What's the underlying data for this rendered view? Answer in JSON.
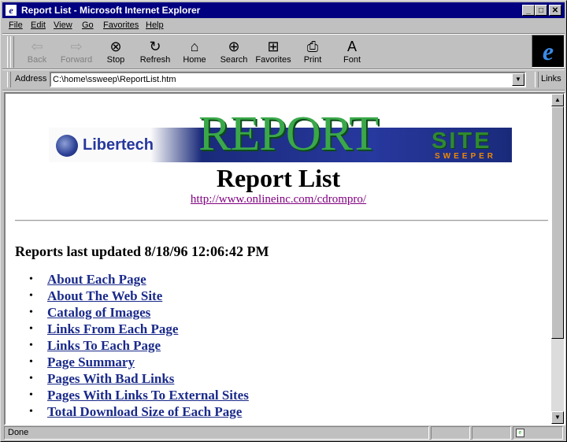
{
  "window": {
    "title": "Report List - Microsoft Internet Explorer",
    "app_icon": "ie-page-icon",
    "controls": {
      "minimize": "_",
      "maximize": "□",
      "close": "✕"
    }
  },
  "menu": [
    "File",
    "Edit",
    "View",
    "Go",
    "Favorites",
    "Help"
  ],
  "toolbar": {
    "buttons": [
      {
        "label": "Back",
        "icon": "back-arrow-icon",
        "enabled": false
      },
      {
        "label": "Forward",
        "icon": "forward-arrow-icon",
        "enabled": false
      },
      {
        "label": "Stop",
        "icon": "stop-icon",
        "enabled": true
      },
      {
        "label": "Refresh",
        "icon": "refresh-icon",
        "enabled": true
      },
      {
        "label": "Home",
        "icon": "home-icon",
        "enabled": true
      },
      {
        "label": "Search",
        "icon": "search-icon",
        "enabled": true
      },
      {
        "label": "Favorites",
        "icon": "favorites-folder-icon",
        "enabled": true
      },
      {
        "label": "Print",
        "icon": "print-icon",
        "enabled": true
      },
      {
        "label": "Font",
        "icon": "font-icon",
        "enabled": true
      }
    ]
  },
  "address": {
    "label": "Address",
    "value": "C:\\home\\ssweep\\ReportList.htm",
    "links_label": "Links"
  },
  "page": {
    "banner": {
      "company": "Libertech",
      "product_word": "REPORT",
      "brand_top": "SITE",
      "brand_bottom": "SWEEPER"
    },
    "title": "Report List",
    "url": "http://www.onlineinc.com/cdrompro/",
    "updated": "Reports last updated 8/18/96 12:06:42 PM",
    "bullet": "•",
    "reports": [
      "About Each Page",
      "About The Web Site",
      "Catalog of Images",
      "Links From Each Page",
      "Links To Each Page",
      "Page Summary",
      "Pages With Bad Links",
      "Pages With Links To External Sites",
      "Total Download Size of Each Page"
    ]
  },
  "status": {
    "text": "Done"
  },
  "colors": {
    "titlebar": "#000080",
    "link": "#1a2a8a",
    "visited": "#800080",
    "chrome": "#c0c0c0"
  }
}
